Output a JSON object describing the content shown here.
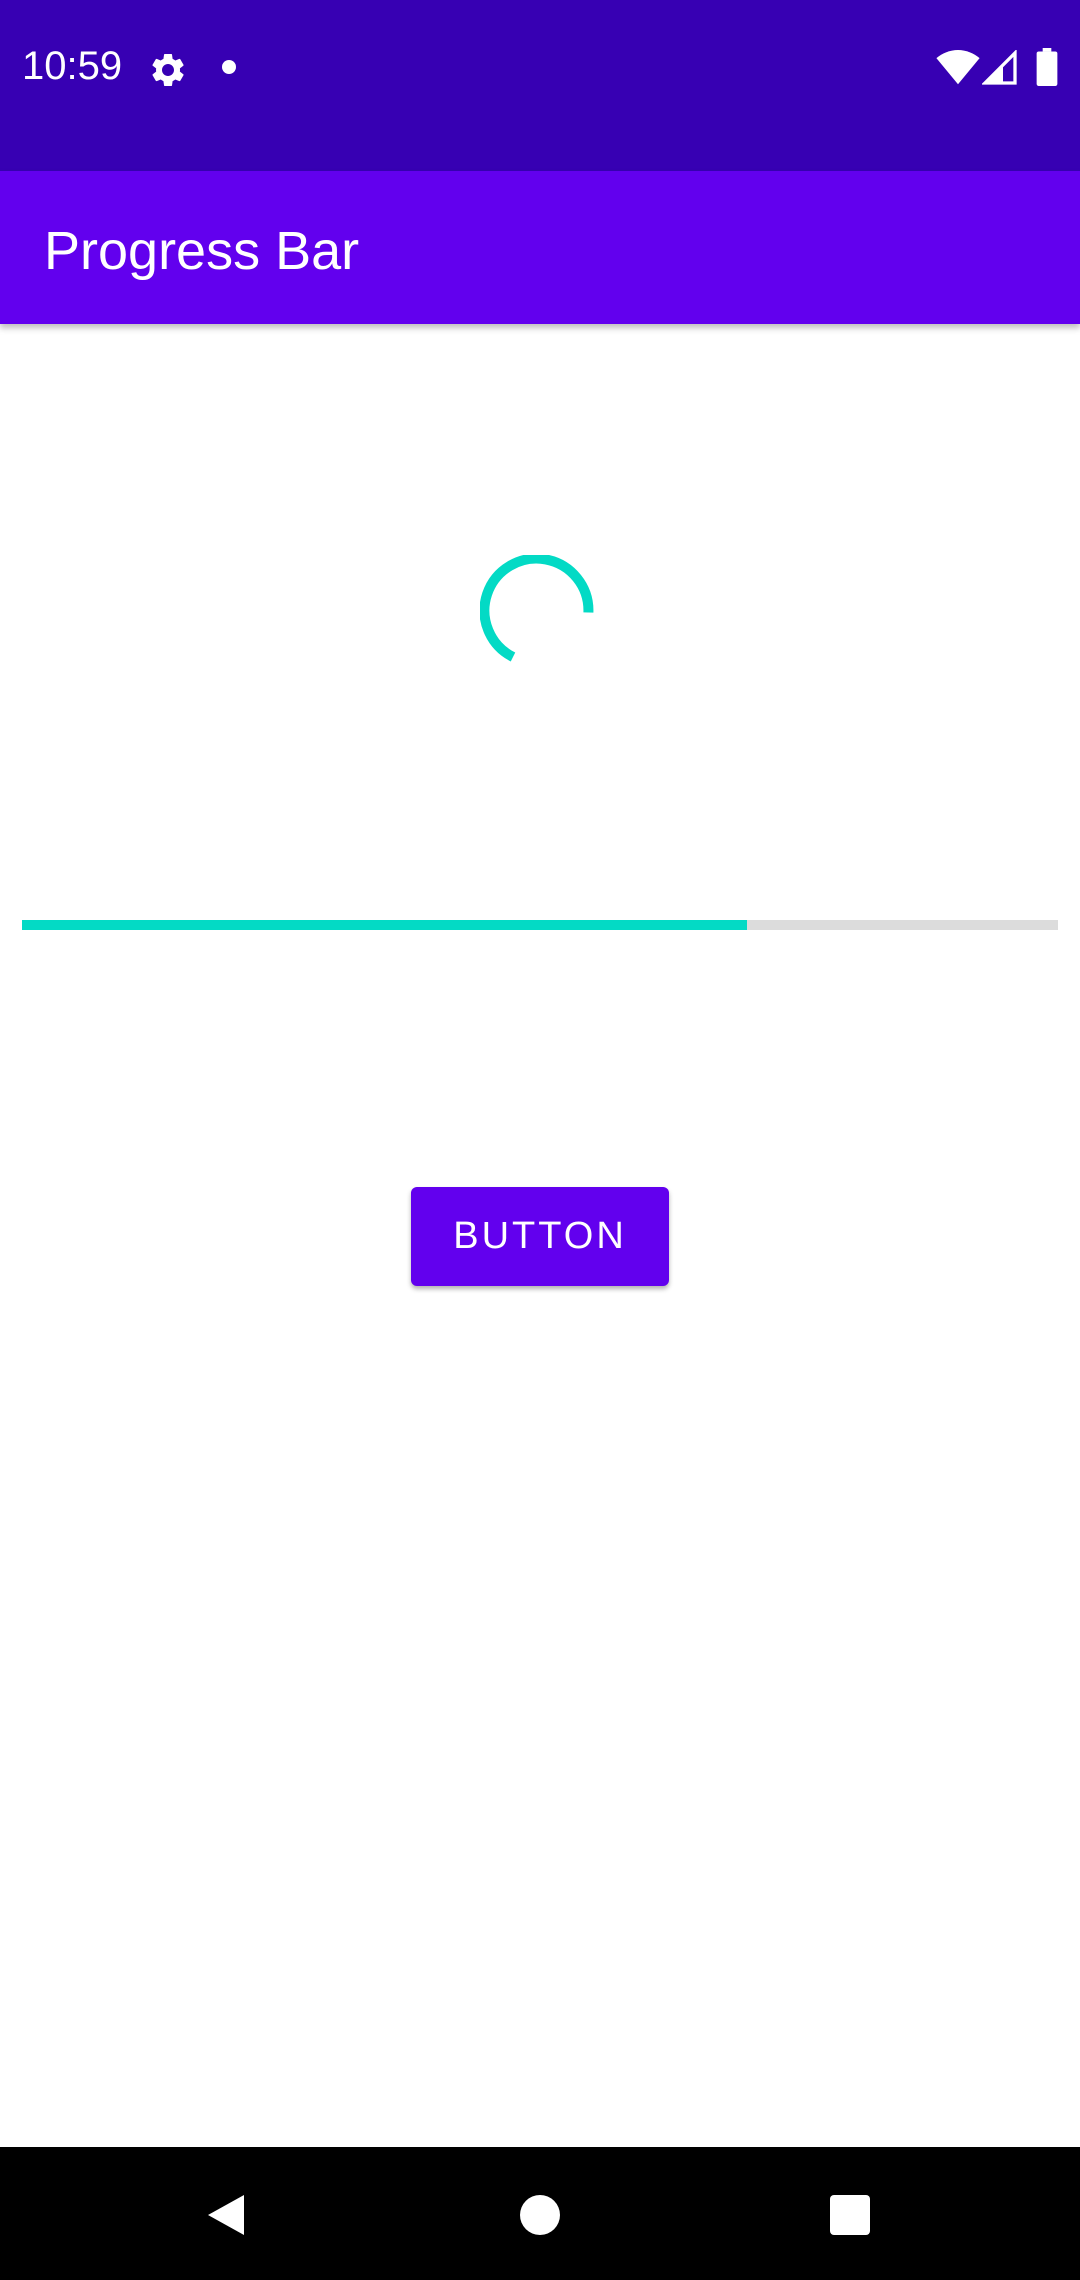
{
  "status_bar": {
    "time": "10:59",
    "icons": [
      "gear-icon",
      "notification-dot-icon",
      "wifi-icon",
      "signal-icon",
      "battery-icon"
    ]
  },
  "app_bar": {
    "title": "Progress Bar"
  },
  "spinner": {
    "icon": "loading-spinner-icon",
    "color": "#03dac5"
  },
  "progress": {
    "value": 0.7,
    "fill_color": "#03dac5",
    "track_color": "#dcdcdc"
  },
  "button": {
    "label": "BUTTON"
  },
  "nav_bar": {
    "icons": [
      "back-icon",
      "home-icon",
      "recents-icon"
    ]
  },
  "colors": {
    "primary": "#6200ee",
    "primary_dark": "#3700b3",
    "accent": "#03dac5"
  }
}
